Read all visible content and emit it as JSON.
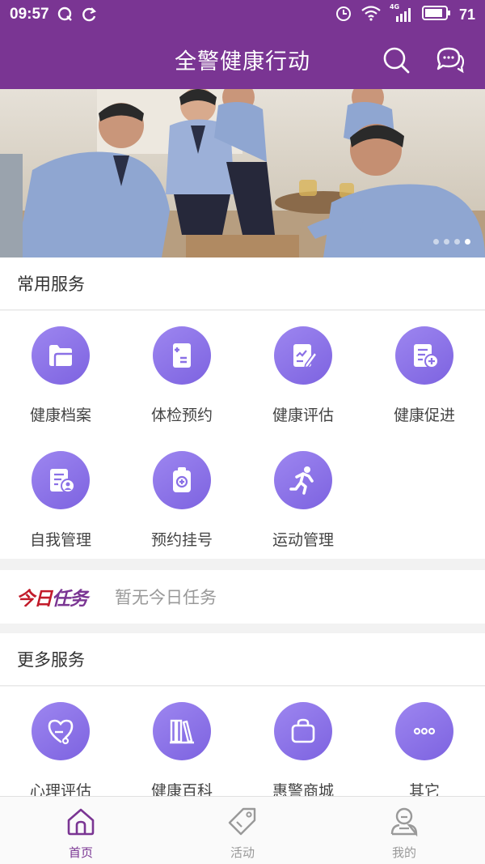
{
  "status_bar": {
    "time": "09:57",
    "battery": "71",
    "network": "4G"
  },
  "header": {
    "title": "全警健康行动"
  },
  "common_services": {
    "title": "常用服务",
    "items": [
      {
        "label": "健康档案",
        "icon": "folder-icon"
      },
      {
        "label": "体检预约",
        "icon": "clipboard-plus-icon"
      },
      {
        "label": "健康评估",
        "icon": "edit-document-icon"
      },
      {
        "label": "健康促进",
        "icon": "document-plus-icon"
      },
      {
        "label": "自我管理",
        "icon": "document-user-icon"
      },
      {
        "label": "预约挂号",
        "icon": "medical-bag-icon"
      },
      {
        "label": "运动管理",
        "icon": "running-icon"
      }
    ]
  },
  "today_task": {
    "brand_part1": "今日",
    "brand_part2": "任务",
    "message": "暂无今日任务"
  },
  "more_services": {
    "title": "更多服务",
    "items": [
      {
        "label": "心理评估",
        "icon": "heart-stethoscope-icon"
      },
      {
        "label": "健康百科",
        "icon": "books-icon"
      },
      {
        "label": "惠警商城",
        "icon": "shopping-bag-icon"
      },
      {
        "label": "其它",
        "icon": "more-dots-icon"
      }
    ]
  },
  "tabbar": {
    "tabs": [
      {
        "label": "首页",
        "icon": "home-icon",
        "active": true
      },
      {
        "label": "活动",
        "icon": "tag-icon",
        "active": false
      },
      {
        "label": "我的",
        "icon": "user-icon",
        "active": false
      }
    ]
  },
  "colors": {
    "primary": "#7a3593",
    "icon_circle": "#8a70e6",
    "brand_red": "#c21b2a"
  },
  "banner": {
    "slides": 4,
    "active_slide": 4
  }
}
